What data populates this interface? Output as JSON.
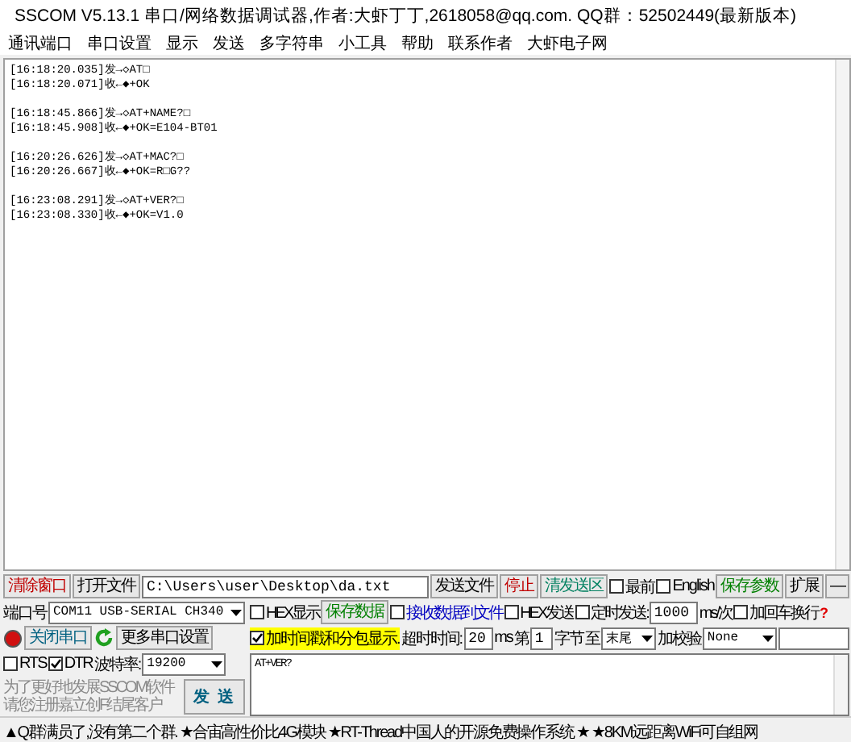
{
  "window": {
    "title": "SSCOM V5.13.1 串口/网络数据调试器,作者:大虾丁丁,2618058@qq.com. QQ群：52502449(最新版本)"
  },
  "menu": [
    "通讯端口",
    "串口设置",
    "显示",
    "发送",
    "多字符串",
    "小工具",
    "帮助",
    "联系作者",
    "大虾电子网"
  ],
  "receive": {
    "groups": [
      [
        "[16:18:20.035]发→◇AT□",
        "[16:18:20.071]收←◆+OK"
      ],
      [
        "[16:18:45.866]发→◇AT+NAME?□",
        "[16:18:45.908]收←◆+OK=E104-BT01"
      ],
      [
        "[16:20:26.626]发→◇AT+MAC?□",
        "[16:20:26.667]收←◆+OK=R□G??"
      ],
      [
        "[16:23:08.291]发→◇AT+VER?□",
        "[16:23:08.330]收←◆+OK=V1.0"
      ]
    ]
  },
  "top_row": [
    {
      "kind": "button",
      "label": "清除窗口",
      "color": "#c00000"
    },
    {
      "kind": "button",
      "label": "打开文件"
    },
    {
      "kind": "path",
      "value": "C:\\Users\\user\\Desktop\\da.txt"
    },
    {
      "kind": "button",
      "label": "发送文件"
    },
    {
      "kind": "button",
      "label": "停止",
      "color": "#c00000"
    },
    {
      "kind": "button",
      "label": "清发送区",
      "color": "#008060"
    },
    {
      "kind": "check",
      "label": "最前",
      "checked": false
    },
    {
      "kind": "check",
      "label": "English",
      "checked": false
    },
    {
      "kind": "button",
      "label": "保存参数",
      "color": "#008000"
    },
    {
      "kind": "button",
      "label": "扩展"
    },
    {
      "kind": "button",
      "label": "—"
    }
  ],
  "left_rows": [
    [
      {
        "kind": "label",
        "label": "端口号"
      },
      {
        "kind": "combo",
        "value": "COM11 USB-SERIAL CH340"
      }
    ],
    [
      {
        "kind": "led",
        "on": true
      },
      {
        "kind": "button",
        "label": "关闭串口",
        "color": "#006080"
      },
      {
        "kind": "refresh"
      },
      {
        "kind": "button",
        "label": "更多串口设置"
      }
    ],
    [
      {
        "kind": "check",
        "label": "RTS",
        "checked": false
      },
      {
        "kind": "check",
        "label": "DTR",
        "checked": true
      },
      {
        "kind": "label",
        "label": "波特率:"
      },
      {
        "kind": "combo",
        "value": "19200"
      }
    ],
    [
      {
        "kind": "hint",
        "lines": [
          "为了更好地发展SSCOM软件",
          "请您注册嘉立创F结尾客户"
        ]
      },
      {
        "kind": "button",
        "label": "发 送",
        "color": "#006080"
      }
    ]
  ],
  "right_rows": [
    [
      {
        "kind": "check",
        "label": "HEX显示",
        "checked": false
      },
      {
        "kind": "button",
        "label": "保存数据",
        "color": "#008000"
      },
      {
        "kind": "check",
        "label": "接收数据到文件",
        "checked": false,
        "color": "#0000c0"
      },
      {
        "kind": "check",
        "label": "HEX发送",
        "checked": false
      },
      {
        "kind": "check",
        "label": "定时发送:",
        "checked": false
      },
      {
        "kind": "field",
        "value": "1000"
      },
      {
        "kind": "label",
        "label": "ms/次"
      },
      {
        "kind": "check",
        "label": "加回车换行",
        "checked": false
      },
      {
        "kind": "help",
        "label": "?"
      }
    ],
    [
      {
        "kind": "check",
        "label": "加时间戳和分包显示.",
        "checked": true,
        "highlight": true
      },
      {
        "kind": "label",
        "label": "超时时间:"
      },
      {
        "kind": "field",
        "value": "20"
      },
      {
        "kind": "label",
        "label": "ms"
      },
      {
        "kind": "label",
        "label": "第"
      },
      {
        "kind": "field",
        "value": "1"
      },
      {
        "kind": "label",
        "label": "字节"
      },
      {
        "kind": "label",
        "label": "至"
      },
      {
        "kind": "combo",
        "value": "末尾"
      },
      {
        "kind": "label",
        "label": "加校验"
      },
      {
        "kind": "combo",
        "value": "None"
      },
      {
        "kind": "field"
      }
    ]
  ],
  "send_box": {
    "value": "AT+VER?"
  },
  "status_bar": "▲Q群满员了,没有第二个群. ★合宙高性价比4G模块 ★RT-Thread中国人的开源免费操作系统 ★ ★8KM远距离WiFi可自组网"
}
